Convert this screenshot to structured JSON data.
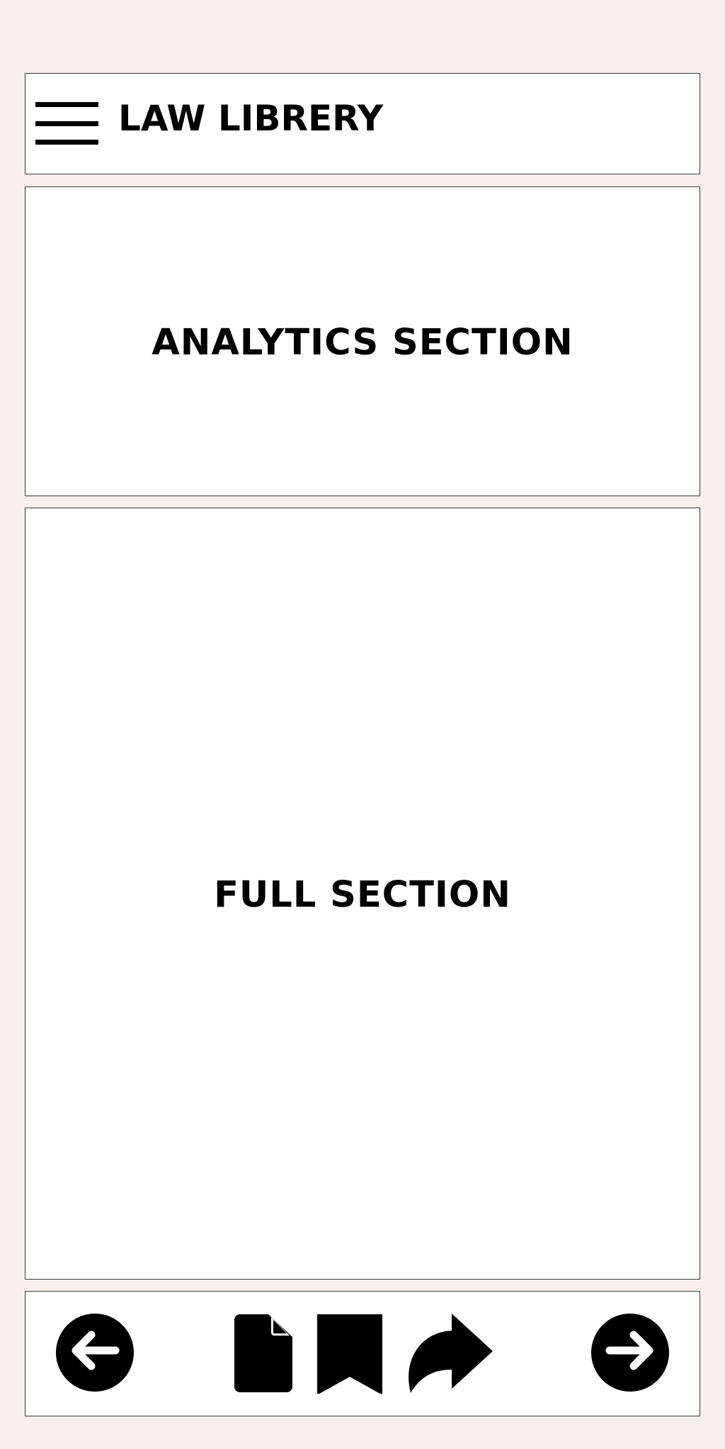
{
  "header": {
    "title": "LAW LIBRERY",
    "menu_icon": "hamburger-menu-icon"
  },
  "analytics": {
    "label": "ANALYTICS SECTION"
  },
  "full": {
    "label": "FULL SECTION"
  },
  "toolbar": {
    "icons": [
      "arrow-left-circle-icon",
      "document-icon",
      "bookmark-icon",
      "share-icon",
      "arrow-right-circle-icon"
    ]
  },
  "colors": {
    "background": "#f8eeee",
    "panel": "#ffffff",
    "border": "#3a3a3a",
    "ink": "#000000"
  }
}
